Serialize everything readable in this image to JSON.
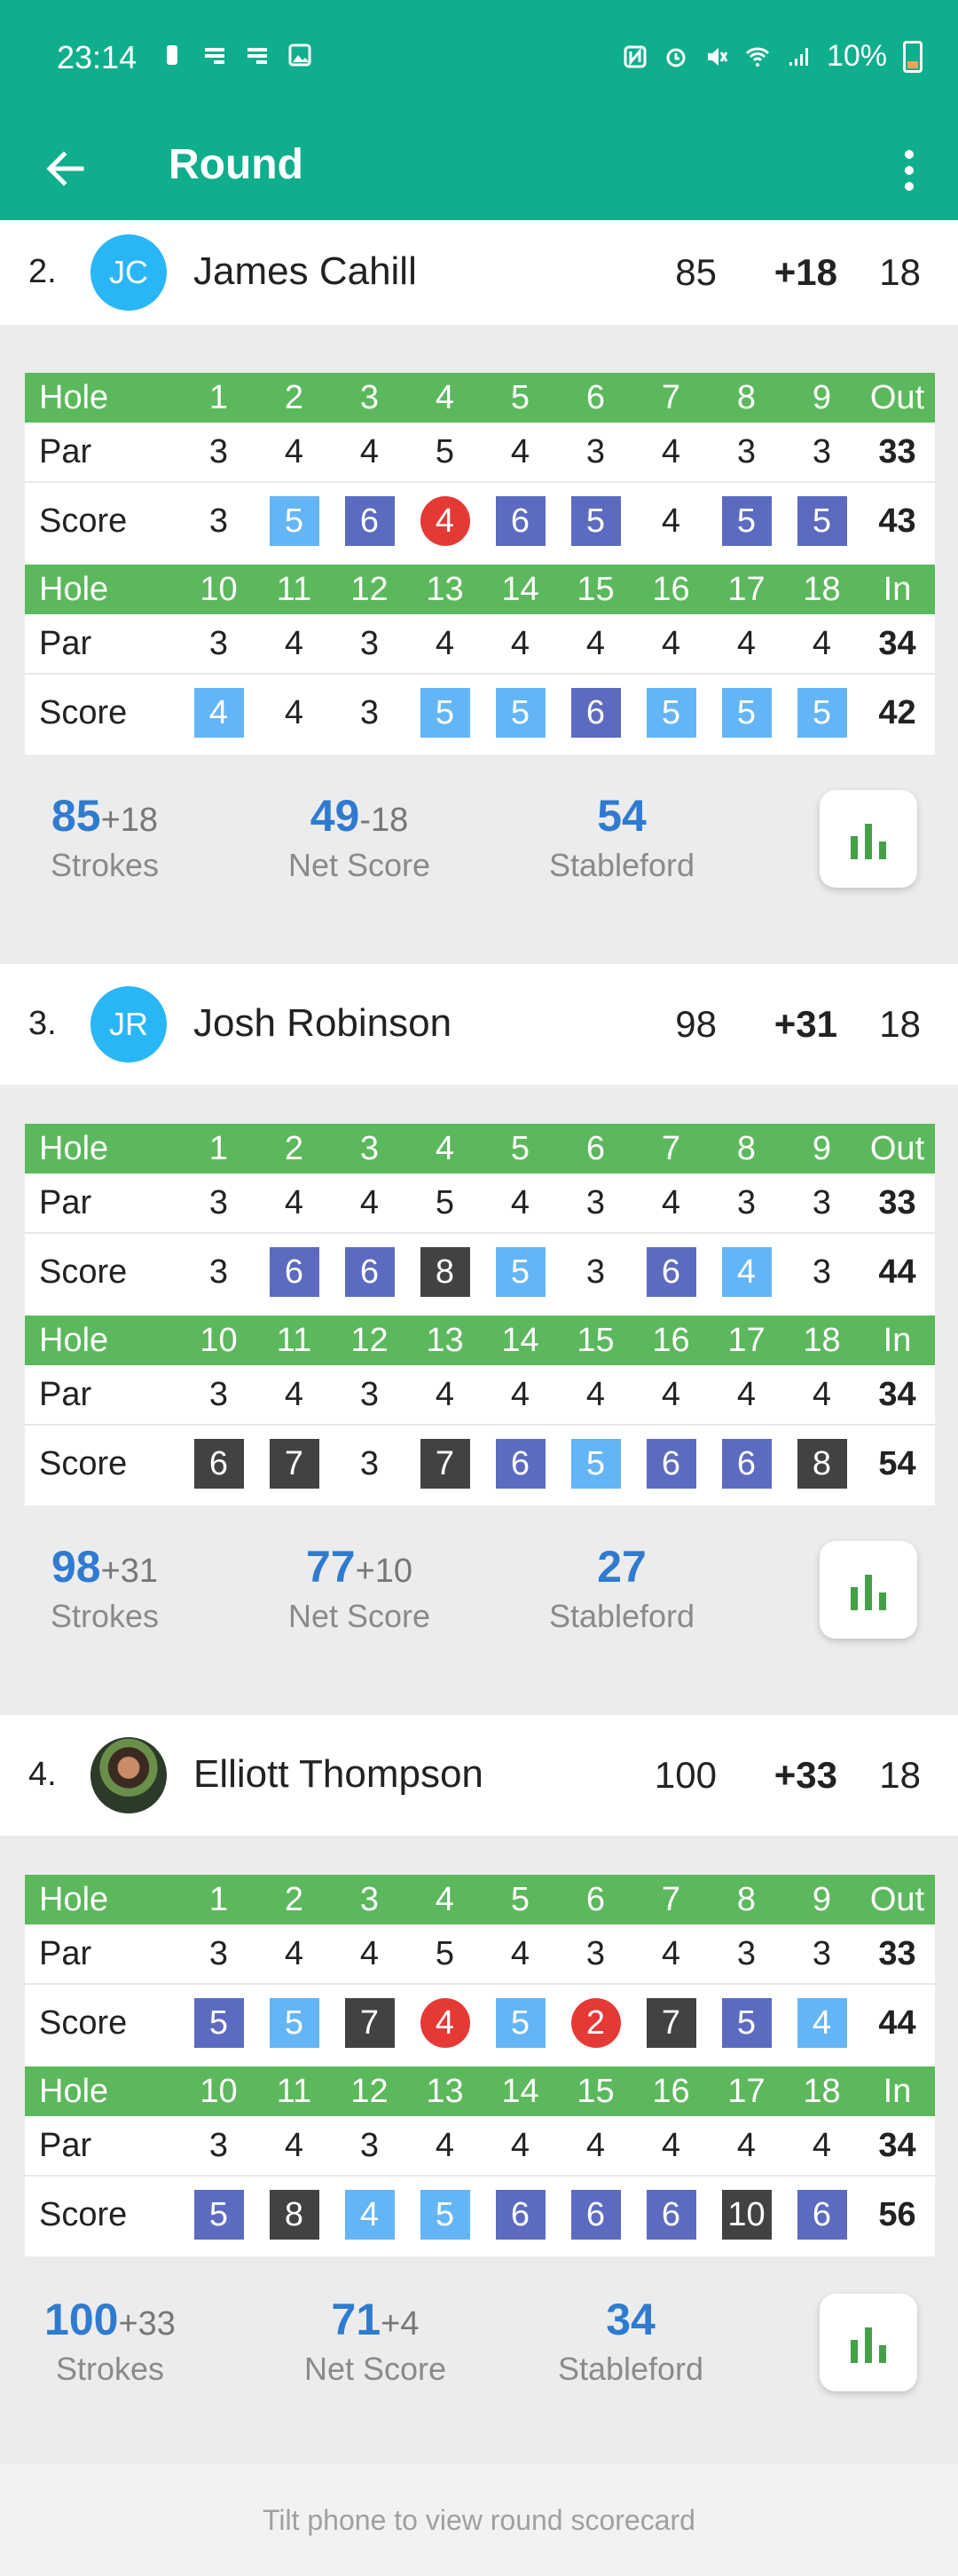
{
  "status_bar": {
    "time": "23:14",
    "battery": "10%"
  },
  "app_bar": {
    "title": "Round"
  },
  "scorecard_labels": {
    "hole": "Hole",
    "par": "Par",
    "score": "Score",
    "out": "Out",
    "in": "In"
  },
  "front_holes": [
    "1",
    "2",
    "3",
    "4",
    "5",
    "6",
    "7",
    "8",
    "9"
  ],
  "back_holes": [
    "10",
    "11",
    "12",
    "13",
    "14",
    "15",
    "16",
    "17",
    "18"
  ],
  "front_par": [
    "3",
    "4",
    "4",
    "5",
    "4",
    "3",
    "4",
    "3",
    "3"
  ],
  "front_par_total": "33",
  "back_par": [
    "3",
    "4",
    "3",
    "4",
    "4",
    "4",
    "4",
    "4",
    "4"
  ],
  "back_par_total": "34",
  "stat_labels": {
    "strokes": "Strokes",
    "net": "Net Score",
    "stableford": "Stableford"
  },
  "players": [
    {
      "position": "2.",
      "initials": "JC",
      "name": "James Cahill",
      "score": "85",
      "to_par": "+18",
      "holes": "18",
      "front_scores": [
        "3",
        "5",
        "6",
        "4",
        "6",
        "5",
        "4",
        "5",
        "5"
      ],
      "front_types": [
        "",
        "lb",
        "db",
        "rd",
        "db",
        "db",
        "",
        "db",
        "db"
      ],
      "front_total": "43",
      "back_scores": [
        "4",
        "4",
        "3",
        "5",
        "5",
        "6",
        "5",
        "5",
        "5"
      ],
      "back_types": [
        "lb",
        "",
        "",
        "lb",
        "lb",
        "db",
        "lb",
        "lb",
        "lb"
      ],
      "back_total": "42",
      "strokes": "85",
      "strokes_diff": "+18",
      "net": "49",
      "net_diff": "-18",
      "stableford": "54"
    },
    {
      "position": "3.",
      "initials": "JR",
      "name": "Josh Robinson",
      "score": "98",
      "to_par": "+31",
      "holes": "18",
      "front_scores": [
        "3",
        "6",
        "6",
        "8",
        "5",
        "3",
        "6",
        "4",
        "3"
      ],
      "front_types": [
        "",
        "db",
        "db",
        "dk",
        "lb",
        "",
        "db",
        "lb",
        ""
      ],
      "front_total": "44",
      "back_scores": [
        "6",
        "7",
        "3",
        "7",
        "6",
        "5",
        "6",
        "6",
        "8"
      ],
      "back_types": [
        "dk",
        "dk",
        "",
        "dk",
        "db",
        "lb",
        "db",
        "db",
        "dk"
      ],
      "back_total": "54",
      "strokes": "98",
      "strokes_diff": "+31",
      "net": "77",
      "net_diff": "+10",
      "stableford": "27"
    },
    {
      "position": "4.",
      "initials": "",
      "name": "Elliott Thompson",
      "score": "100",
      "to_par": "+33",
      "holes": "18",
      "front_scores": [
        "5",
        "5",
        "7",
        "4",
        "5",
        "2",
        "7",
        "5",
        "4"
      ],
      "front_types": [
        "db",
        "lb",
        "dk",
        "rd",
        "lb",
        "rd",
        "dk",
        "db",
        "lb"
      ],
      "front_total": "44",
      "back_scores": [
        "5",
        "8",
        "4",
        "5",
        "6",
        "6",
        "6",
        "10",
        "6"
      ],
      "back_types": [
        "db",
        "dk",
        "lb",
        "lb",
        "db",
        "db",
        "db",
        "dk",
        "db"
      ],
      "back_total": "56",
      "strokes": "100",
      "strokes_diff": "+33",
      "net": "71",
      "net_diff": "+4",
      "stableford": "34"
    }
  ],
  "footer": {
    "hint": "Tilt phone to view round scorecard"
  },
  "colors": {
    "app_bar": "#0fae8c",
    "table_header": "#5cb85c",
    "stat_value": "#2f7bd0",
    "badge_light_blue": "#64b5f6",
    "badge_dark_blue": "#5c6bc0",
    "badge_dark": "#424242",
    "badge_red": "#e53935"
  }
}
